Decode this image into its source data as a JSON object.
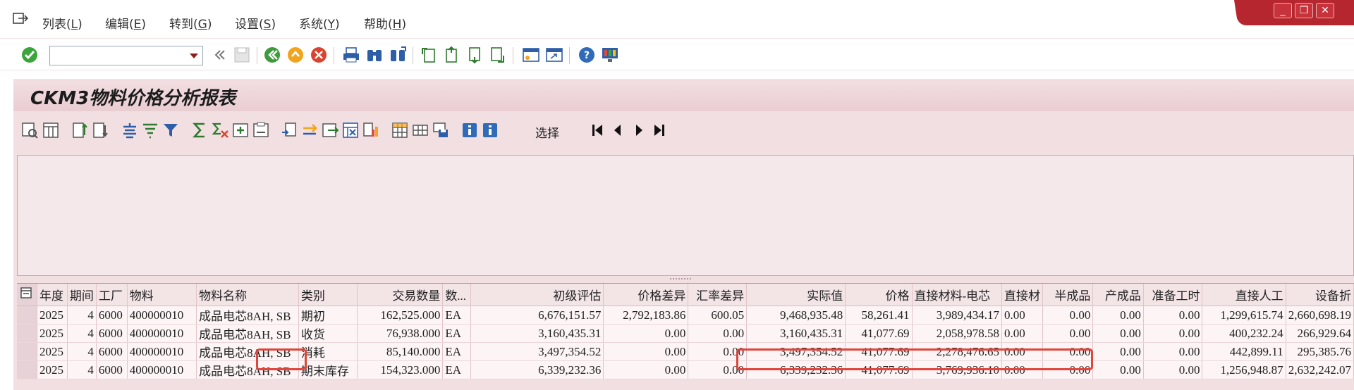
{
  "menu": {
    "items": [
      {
        "label": "列表(",
        "key": "L",
        "suffix": ")"
      },
      {
        "label": "编辑(",
        "key": "E",
        "suffix": ")"
      },
      {
        "label": "转到(",
        "key": "G",
        "suffix": ")"
      },
      {
        "label": "设置(",
        "key": "S",
        "suffix": ")"
      },
      {
        "label": "系统(",
        "key": "Y",
        "suffix": ")"
      },
      {
        "label": "帮助(",
        "key": "H",
        "suffix": ")"
      }
    ]
  },
  "command_field": {
    "value": ""
  },
  "window_controls": {
    "minimize": "_",
    "restore": "❐",
    "close": "✕"
  },
  "page": {
    "title": "CKM3物料价格分析报表"
  },
  "alv_toolbar": {
    "select_label": "选择"
  },
  "colors": {
    "accent": "#e1443a",
    "panel": "#f2dfe2",
    "title_bar": "#e9cdd2",
    "window_close": "#c8323a"
  },
  "table": {
    "columns": [
      "年度",
      "期间",
      "工厂",
      "物料",
      "物料名称",
      "类别",
      "交易数量",
      "数...",
      "初级评估",
      "价格差异",
      "汇率差异",
      "实际值",
      "价格",
      "直接材料-电芯",
      "直接材",
      "半成品",
      "产成品",
      "准备工时",
      "直接人工",
      "设备折"
    ],
    "rows": [
      [
        "2025",
        "4",
        "6000",
        "400000010",
        "成品电芯8AH, SB",
        "期初",
        "162,525.000",
        "EA",
        "6,676,151.57",
        "2,792,183.86",
        "600.05",
        "9,468,935.48",
        "58,261.41",
        "3,989,434.17",
        "0.00",
        "0.00",
        "0.00",
        "0.00",
        "1,299,615.74",
        "2,660,698.19"
      ],
      [
        "2025",
        "4",
        "6000",
        "400000010",
        "成品电芯8AH, SB",
        "收货",
        "76,938.000",
        "EA",
        "3,160,435.31",
        "0.00",
        "0.00",
        "3,160,435.31",
        "41,077.69",
        "2,058,978.58",
        "0.00",
        "0.00",
        "0.00",
        "0.00",
        "400,232.24",
        "266,929.64"
      ],
      [
        "2025",
        "4",
        "6000",
        "400000010",
        "成品电芯8AH, SB",
        "消耗",
        "85,140.000",
        "EA",
        "3,497,354.52",
        "0.00",
        "0.00",
        "3,497,354.52",
        "41,077.69",
        "2,278,476.65",
        "0.00",
        "0.00",
        "0.00",
        "0.00",
        "442,899.11",
        "295,385.76"
      ],
      [
        "2025",
        "4",
        "6000",
        "400000010",
        "成品电芯8AH, SB",
        "期末库存",
        "154,323.000",
        "EA",
        "6,339,232.36",
        "0.00",
        "0.00",
        "6,339,232.36",
        "41,077.69",
        "3,769,936.10",
        "0.00",
        "0.00",
        "0.00",
        "0.00",
        "1,256,948.87",
        "2,632,242.07"
      ]
    ]
  }
}
